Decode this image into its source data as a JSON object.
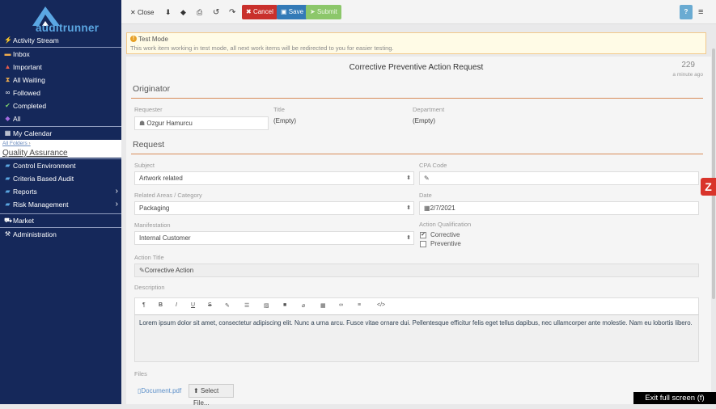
{
  "brand": {
    "name": "auditrunner"
  },
  "sidebar": {
    "items": [
      {
        "label": "Activity Stream",
        "icon": "bolt-icon"
      },
      {
        "label": "Inbox",
        "icon": "inbox-icon"
      },
      {
        "label": "Important",
        "icon": "warning-icon"
      },
      {
        "label": "All Waiting",
        "icon": "hourglass-icon"
      },
      {
        "label": "Followed",
        "icon": "binoculars-icon"
      },
      {
        "label": "Completed",
        "icon": "check-icon"
      },
      {
        "label": "All",
        "icon": "tag-icon"
      },
      {
        "label": "My Calendar",
        "icon": "calendar-icon"
      }
    ],
    "breadcrumb": {
      "root": "All Folders",
      "separator": "›",
      "current": "Quality Assurance"
    },
    "folders": [
      {
        "label": "Control Environment",
        "icon": "folder-icon"
      },
      {
        "label": "Criteria Based Audit",
        "icon": "folder-icon"
      },
      {
        "label": "Reports",
        "icon": "folder-icon",
        "arrow": "›"
      },
      {
        "label": "Risk Management",
        "icon": "folder-icon",
        "arrow": "›"
      }
    ],
    "market": {
      "label": "Market",
      "icon": "cart-icon"
    },
    "admin": {
      "label": "Administration",
      "icon": "wrench-icon"
    }
  },
  "toolbar": {
    "close": "Close",
    "cancel": "Cancel",
    "save": "Save",
    "submit": "Submit",
    "help": "?",
    "menu": "≡"
  },
  "alert": {
    "title": "Test Mode",
    "message": "This work item working in test mode, all next work items will be redirected to you for easier testing."
  },
  "form": {
    "title": "Corrective Preventive Action Request",
    "id": "229",
    "time": "a minute ago",
    "originator": {
      "section": "Originator",
      "requester_label": "Requester",
      "requester": "Ozgur Hamurcu",
      "title_label": "Title",
      "title": "(Empty)",
      "department_label": "Department",
      "department": "(Empty)"
    },
    "request": {
      "section": "Request",
      "subject_label": "Subject",
      "subject": "Artwork related",
      "cpa_label": "CPA Code",
      "cpa": "",
      "areas_label": "Related Areas / Category",
      "areas": "Packaging",
      "date_label": "Date",
      "date": "2/7/2021",
      "manifestation_label": "Manifestation",
      "manifestation": "Internal Customer",
      "qualification_label": "Action Qualification",
      "qualifications": [
        {
          "label": "Corrective",
          "checked": true
        },
        {
          "label": "Preventive",
          "checked": false
        }
      ],
      "action_title_label": "Action Title",
      "action_title": "Corrective Action",
      "description_label": "Description",
      "description": "Lorem ipsum dolor sit amet, consectetur adipiscing elit. Nunc a urna arcu. Fusce vitae ornare dui. Pellentesque efficitur felis eget tellus dapibus, nec ullamcorper ante molestie. Nam eu lobortis libero.",
      "files_label": "Files",
      "file": "Document.pdf",
      "select_file": "Select File..."
    }
  },
  "fullscreen": "Exit full screen (f)",
  "colors": {
    "sidebar": "#15285a",
    "accent": "#5ba7e3",
    "cancel": "#c9302c",
    "save": "#337ab7",
    "submit": "#8cc76a",
    "section_line": "#d88c5a"
  }
}
